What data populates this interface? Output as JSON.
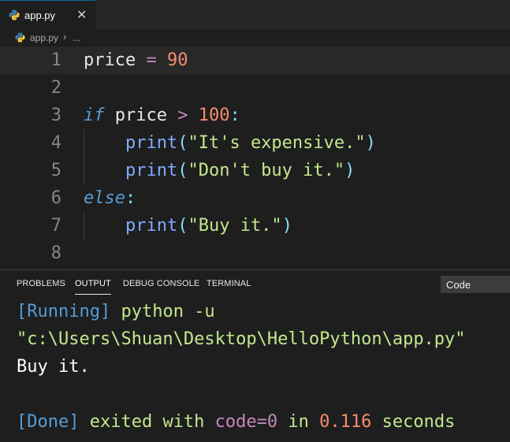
{
  "tab": {
    "filename": "app.py",
    "close": "✕"
  },
  "breadcrumb": {
    "file": "app.py",
    "separator": "›",
    "more": "..."
  },
  "editor": {
    "line_numbers": [
      "1",
      "2",
      "3",
      "4",
      "5",
      "6",
      "7",
      "8"
    ],
    "line1": {
      "var": "price",
      "op": " = ",
      "num": "90"
    },
    "line3": {
      "kw": "if",
      "var": " price ",
      "op": ">",
      "num": " 100",
      "punct": ":"
    },
    "line4": {
      "indent": "    ",
      "fn": "print",
      "open": "(",
      "str": "\"It's expensive.\"",
      "close": ")"
    },
    "line5": {
      "indent": "    ",
      "fn": "print",
      "open": "(",
      "str": "\"Don't buy it.\"",
      "close": ")"
    },
    "line6": {
      "kw": "else",
      "punct": ":"
    },
    "line7": {
      "indent": "    ",
      "fn": "print",
      "open": "(",
      "str": "\"Buy it.\"",
      "close": ")"
    }
  },
  "panel": {
    "tabs": [
      "PROBLEMS",
      "OUTPUT",
      "DEBUG CONSOLE",
      "TERMINAL"
    ],
    "active_tab": "OUTPUT",
    "dropdown_value": "Code",
    "output": {
      "running_tag": "[Running]",
      "command": " python -u",
      "path": "\"c:\\Users\\Shuan\\Desktop\\HelloPython\\app.py\"",
      "result": "Buy it.",
      "done_tag": "[Done]",
      "exited_with": " exited with ",
      "code": "code=0",
      "in_word": " in ",
      "time": "0.116",
      "seconds": " seconds"
    }
  },
  "colors": {
    "background": "#1e1e1e",
    "keyword": "#569cd6",
    "string": "#c3e88d",
    "number": "#f78c6c",
    "function": "#82aaff",
    "operator": "#c586c0"
  }
}
